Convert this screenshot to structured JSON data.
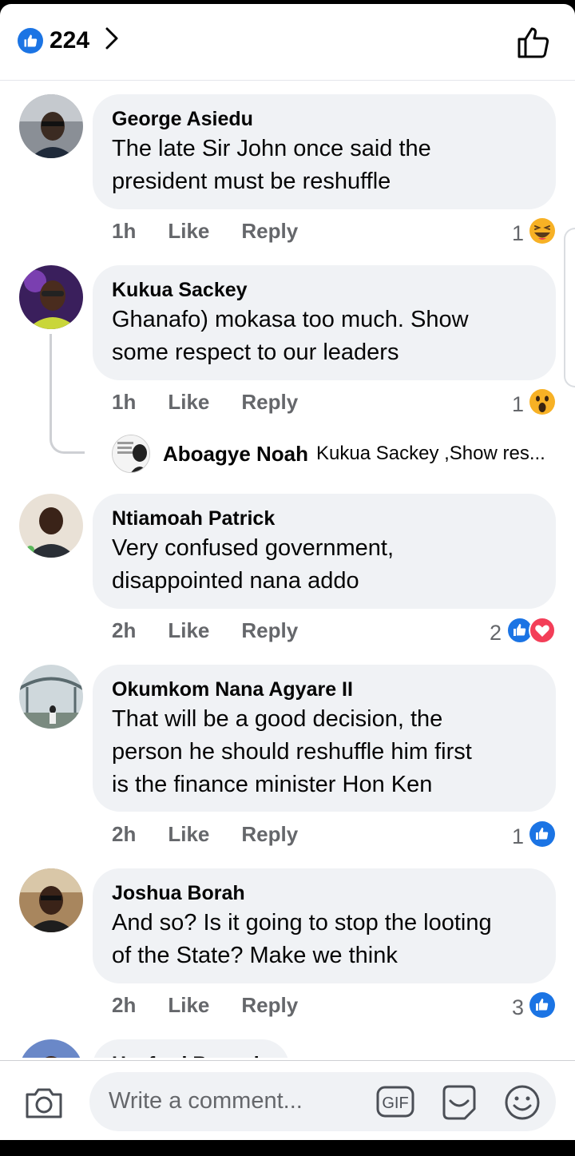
{
  "header": {
    "like_count": "224"
  },
  "comments": [
    {
      "name": "George Asiedu",
      "text_lines": [
        "The late Sir John once said the",
        "president must be reshuffle"
      ],
      "time": "1h",
      "like": "Like",
      "reply": "Reply",
      "reaction_count": "1",
      "reactions": [
        "haha"
      ]
    },
    {
      "name": "Kukua Sackey",
      "text_lines": [
        "Ghanafo) mokasa too much. Show",
        "some respect to our leaders"
      ],
      "time": "1h",
      "like": "Like",
      "reply": "Reply",
      "reaction_count": "1",
      "reactions": [
        "wow"
      ],
      "reply_preview": {
        "name": "Aboagye Noah",
        "text": "Kukua Sackey ,Show res..."
      }
    },
    {
      "name": "Ntiamoah Patrick",
      "text_lines": [
        "Very confused government,",
        "disappointed nana addo"
      ],
      "time": "2h",
      "like": "Like",
      "reply": "Reply",
      "reaction_count": "2",
      "reactions": [
        "like",
        "love"
      ]
    },
    {
      "name": "Okumkom Nana Agyare II",
      "text_lines": [
        "That will be a good decision, the",
        "person he should reshuffle him first",
        "is the finance minister Hon Ken"
      ],
      "time": "2h",
      "like": "Like",
      "reply": "Reply",
      "reaction_count": "1",
      "reactions": [
        "like"
      ]
    },
    {
      "name": "Joshua Borah",
      "text_lines": [
        "And so? Is it going to stop the looting",
        "of the State? Make we think"
      ],
      "time": "2h",
      "like": "Like",
      "reply": "Reply",
      "reaction_count": "3",
      "reactions": [
        "like"
      ]
    },
    {
      "name": "Hexford Bonsah"
    }
  ],
  "composer": {
    "placeholder": "Write a comment...",
    "gif_label": "GIF"
  },
  "colors": {
    "facebook_blue": "#1b74e4",
    "love_red": "#f33e58",
    "emoji_yellow": "#f7b125",
    "bubble_bg": "#f0f2f5",
    "meta_gray": "#65676b"
  }
}
